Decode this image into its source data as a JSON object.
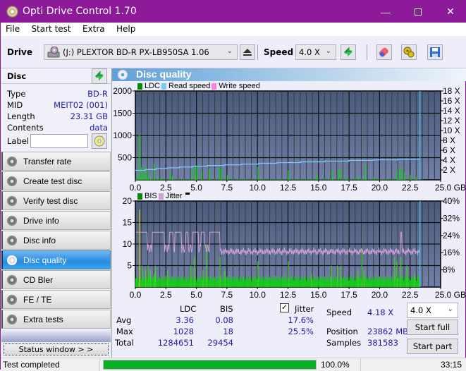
{
  "window": {
    "title": "Opti Drive Control 1.70",
    "controls": {
      "minimize": "—",
      "maximize": "☐",
      "close": "✕"
    }
  },
  "menu": [
    "File",
    "Start test",
    "Extra",
    "Help"
  ],
  "toolbar": {
    "drive_label": "Drive",
    "drive_value": "(J:)  PLEXTOR BD-R  PX-LB950SA 1.06",
    "speed_label": "Speed",
    "speed_value": "4.0 X",
    "icons": [
      "eject-icon",
      "refresh-icon",
      "erase-icon",
      "settings-icon",
      "save-icon"
    ]
  },
  "disc": {
    "header": "Disc",
    "props": [
      {
        "label": "Type",
        "value": "BD-R"
      },
      {
        "label": "MID",
        "value": "MEIT02 (001)"
      },
      {
        "label": "Length",
        "value": "23.31 GB"
      },
      {
        "label": "Contents",
        "value": "data"
      }
    ],
    "label_label": "Label",
    "label_value": ""
  },
  "nav": [
    {
      "label": "Transfer rate",
      "active": false
    },
    {
      "label": "Create test disc",
      "active": false
    },
    {
      "label": "Verify test disc",
      "active": false
    },
    {
      "label": "Drive info",
      "active": false
    },
    {
      "label": "Disc info",
      "active": false
    },
    {
      "label": "Disc quality",
      "active": true
    },
    {
      "label": "CD Bler",
      "active": false
    },
    {
      "label": "FE / TE",
      "active": false
    },
    {
      "label": "Extra tests",
      "active": false
    }
  ],
  "status_window_label": "Status window > >",
  "panel_title": "Disc quality",
  "colors": {
    "ldc": "#0a8a0a",
    "read_speed": "#7ec8f8",
    "write_speed": "#ff80e0",
    "bis": "#0a8a0a",
    "jitter": "#d0a0d8",
    "bar_green": "#10d010",
    "plot_bg_top": "#4a5a7a",
    "plot_bg_bottom": "#7080a8",
    "progress": "#06b025",
    "accent_value": "#1a1aa8"
  },
  "chart_data": [
    {
      "type": "bar",
      "title": "LDC / Read speed",
      "legend": [
        "LDC",
        "Read speed",
        "Write speed"
      ],
      "legend_position": "top-left",
      "xlabel": "GB",
      "x_ticks": [
        "0.0",
        "2.5",
        "5.0",
        "7.5",
        "10.0",
        "12.5",
        "15.0",
        "17.5",
        "20.0",
        "22.5",
        "25.0 GB"
      ],
      "xlim": [
        0,
        25
      ],
      "y_left_ticks": [
        "500",
        "1000",
        "1500",
        "2000"
      ],
      "ylim_left": [
        0,
        2000
      ],
      "y_right_ticks": [
        "2 X",
        "4 X",
        "6 X",
        "8 X",
        "10 X",
        "12 X",
        "14 X",
        "16 X",
        "18 X"
      ],
      "ylim_right": [
        0,
        18
      ],
      "grid": true,
      "end_marker_gb": 23.31,
      "ldc_spikes": [
        {
          "x": 0.1,
          "y": 90
        },
        {
          "x": 0.3,
          "y": 1028
        },
        {
          "x": 0.45,
          "y": 280
        },
        {
          "x": 0.6,
          "y": 130
        },
        {
          "x": 0.75,
          "y": 310
        },
        {
          "x": 0.9,
          "y": 90
        },
        {
          "x": 1.0,
          "y": 220
        },
        {
          "x": 1.2,
          "y": 60
        },
        {
          "x": 1.5,
          "y": 360
        },
        {
          "x": 1.8,
          "y": 40
        },
        {
          "x": 2.1,
          "y": 70
        },
        {
          "x": 2.8,
          "y": 150
        },
        {
          "x": 3.0,
          "y": 80
        },
        {
          "x": 4.6,
          "y": 260
        },
        {
          "x": 4.9,
          "y": 330
        },
        {
          "x": 5.0,
          "y": 300
        },
        {
          "x": 5.4,
          "y": 190
        },
        {
          "x": 6.0,
          "y": 250
        },
        {
          "x": 6.8,
          "y": 280
        },
        {
          "x": 7.0,
          "y": 260
        },
        {
          "x": 7.5,
          "y": 120
        },
        {
          "x": 10.0,
          "y": 290
        },
        {
          "x": 12.5,
          "y": 210
        },
        {
          "x": 14.8,
          "y": 120
        },
        {
          "x": 16.1,
          "y": 210
        },
        {
          "x": 16.6,
          "y": 220
        },
        {
          "x": 16.8,
          "y": 250
        },
        {
          "x": 17.2,
          "y": 60
        },
        {
          "x": 18.2,
          "y": 90
        },
        {
          "x": 18.8,
          "y": 350
        },
        {
          "x": 19.5,
          "y": 80
        },
        {
          "x": 21.4,
          "y": 200
        },
        {
          "x": 21.6,
          "y": 250
        },
        {
          "x": 21.8,
          "y": 280
        },
        {
          "x": 22.0,
          "y": 160
        },
        {
          "x": 22.5,
          "y": 120
        },
        {
          "x": 23.0,
          "y": 60
        }
      ],
      "read_speed": [
        {
          "x": 0.0,
          "y": 1.92
        },
        {
          "x": 0.8,
          "y": 1.92
        },
        {
          "x": 0.8,
          "y": 2.1
        },
        {
          "x": 1.7,
          "y": 2.1
        },
        {
          "x": 1.7,
          "y": 2.3
        },
        {
          "x": 2.6,
          "y": 2.3
        },
        {
          "x": 2.6,
          "y": 2.45
        },
        {
          "x": 3.6,
          "y": 2.45
        },
        {
          "x": 3.6,
          "y": 2.6
        },
        {
          "x": 4.7,
          "y": 2.6
        },
        {
          "x": 4.7,
          "y": 2.75
        },
        {
          "x": 5.9,
          "y": 2.75
        },
        {
          "x": 5.9,
          "y": 2.9
        },
        {
          "x": 7.3,
          "y": 2.9
        },
        {
          "x": 7.3,
          "y": 3.05
        },
        {
          "x": 8.7,
          "y": 3.05
        },
        {
          "x": 8.7,
          "y": 3.2
        },
        {
          "x": 10.1,
          "y": 3.2
        },
        {
          "x": 10.1,
          "y": 3.35
        },
        {
          "x": 11.6,
          "y": 3.35
        },
        {
          "x": 11.6,
          "y": 3.5
        },
        {
          "x": 13.5,
          "y": 3.5
        },
        {
          "x": 13.5,
          "y": 3.65
        },
        {
          "x": 15.5,
          "y": 3.65
        },
        {
          "x": 15.5,
          "y": 3.8
        },
        {
          "x": 17.5,
          "y": 3.8
        },
        {
          "x": 17.5,
          "y": 3.95
        },
        {
          "x": 19.5,
          "y": 3.95
        },
        {
          "x": 19.5,
          "y": 4.05
        },
        {
          "x": 21.5,
          "y": 4.05
        },
        {
          "x": 21.5,
          "y": 4.15
        },
        {
          "x": 23.31,
          "y": 4.18
        }
      ]
    },
    {
      "type": "bar",
      "title": "BIS / Jitter",
      "legend": [
        "BIS",
        "Jitter"
      ],
      "legend_position": "top-left",
      "xlabel": "GB",
      "x_ticks": [
        "0.0",
        "2.5",
        "5.0",
        "7.5",
        "10.0",
        "12.5",
        "15.0",
        "17.5",
        "20.0",
        "22.5",
        "25.0 GB"
      ],
      "xlim": [
        0,
        25
      ],
      "y_left_ticks": [
        "5",
        "10",
        "15",
        "20"
      ],
      "ylim_left": [
        0,
        20
      ],
      "y_right_ticks": [
        "8%",
        "16%",
        "24%",
        "32%",
        "40%"
      ],
      "ylim_right": [
        0,
        40
      ],
      "grid": true,
      "end_marker_gb": 23.31,
      "bis_spikes": [
        {
          "x": 0.3,
          "y": 18
        },
        {
          "x": 0.5,
          "y": 5
        },
        {
          "x": 0.8,
          "y": 4
        },
        {
          "x": 1.0,
          "y": 5
        },
        {
          "x": 1.2,
          "y": 4
        },
        {
          "x": 1.5,
          "y": 3
        },
        {
          "x": 1.6,
          "y": 5
        },
        {
          "x": 2.6,
          "y": 4
        },
        {
          "x": 4.5,
          "y": 5
        },
        {
          "x": 4.8,
          "y": 7
        },
        {
          "x": 5.5,
          "y": 4
        },
        {
          "x": 5.8,
          "y": 10
        },
        {
          "x": 6.9,
          "y": 7
        },
        {
          "x": 7.3,
          "y": 4
        },
        {
          "x": 10.0,
          "y": 6
        },
        {
          "x": 12.5,
          "y": 6
        },
        {
          "x": 14.4,
          "y": 3
        },
        {
          "x": 16.0,
          "y": 5
        },
        {
          "x": 16.5,
          "y": 5
        },
        {
          "x": 16.8,
          "y": 5
        },
        {
          "x": 18.2,
          "y": 4
        },
        {
          "x": 18.5,
          "y": 9
        },
        {
          "x": 18.7,
          "y": 4
        },
        {
          "x": 21.2,
          "y": 7
        },
        {
          "x": 21.4,
          "y": 6
        },
        {
          "x": 21.7,
          "y": 7
        },
        {
          "x": 22.2,
          "y": 5
        },
        {
          "x": 22.8,
          "y": 3
        }
      ],
      "bis_baseline": 2,
      "jitter_summary": {
        "segment_0_7gb": {
          "low_pct": 16,
          "high_pct": 25.5
        },
        "segment_7_23gb": {
          "typical_pct": 16.5
        },
        "peak": {
          "x": 21.8,
          "pct": 25.5
        }
      }
    }
  ],
  "legend_top": {
    "ldc": "LDC",
    "read": "Read speed",
    "write": "Write speed"
  },
  "legend_bottom": {
    "bis": "BIS",
    "jitter": "Jitter"
  },
  "stats": {
    "col_ldc": "LDC",
    "col_bis": "BIS",
    "jitter_label": "Jitter",
    "jitter_checked": true,
    "rows": [
      {
        "label": "Avg",
        "ldc": "3.36",
        "bis": "0.08",
        "jitter": "17.6%"
      },
      {
        "label": "Max",
        "ldc": "1028",
        "bis": "18",
        "jitter": "25.5%"
      },
      {
        "label": "Total",
        "ldc": "1284651",
        "bis": "29454",
        "jitter": ""
      }
    ],
    "speed_label": "Speed",
    "speed_value": "4.18 X",
    "position_label": "Position",
    "position_value": "23862 MB",
    "samples_label": "Samples",
    "samples_value": "381583",
    "speed_select": "4.0 X",
    "start_full": "Start full",
    "start_part": "Start part"
  },
  "statusbar": {
    "message": "Test completed",
    "progress": 1.0,
    "progress_text": "100.0%",
    "time": "33:15"
  }
}
